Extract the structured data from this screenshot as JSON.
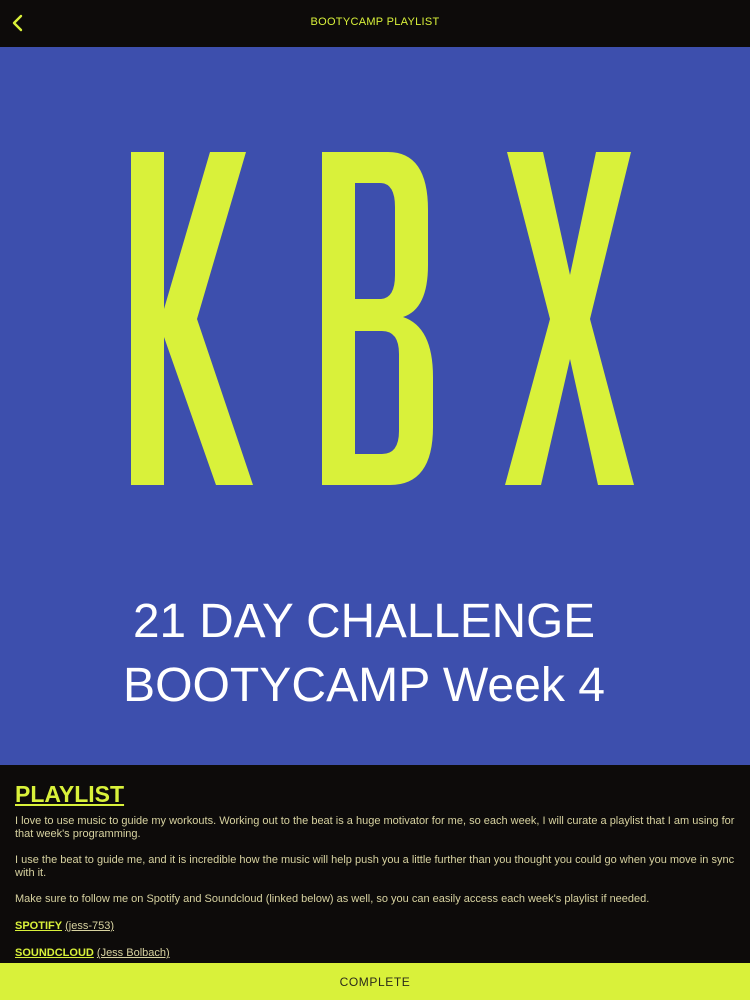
{
  "colors": {
    "background": "#0d0b0a",
    "accent": "#d9f13a",
    "hero_blue": "#3d4fad",
    "hero_text": "#ffffff",
    "body_text": "#d7d2a0",
    "button_text": "#2a2a1a"
  },
  "topbar": {
    "back_icon": "chevron-left-icon",
    "title": "BOOTYCAMP PLAYLIST"
  },
  "hero": {
    "logo_text": "KBX",
    "line1": "21 DAY CHALLENGE",
    "line2": "BOOTYCAMP Week 4"
  },
  "playlist": {
    "heading": "PLAYLIST",
    "paragraphs": [
      "I love to use music to guide my workouts. Working out to the beat is a huge motivator for me, so each week, I will curate a playlist that I am using for that week's programming.",
      "I use the beat to guide me, and it is incredible how the music will help push you a little further than you thought you could go when you move in sync with it.",
      "Make sure to follow me on Spotify and Soundcloud (linked below) as well, so you can easily access each week's playlist if needed."
    ],
    "links": [
      {
        "service": "SPOTIFY",
        "handle": "(jess-753)"
      },
      {
        "service": "SOUNDCLOUD",
        "handle": "(Jess Bolbach)"
      }
    ]
  },
  "complete_button": {
    "label": "COMPLETE"
  }
}
